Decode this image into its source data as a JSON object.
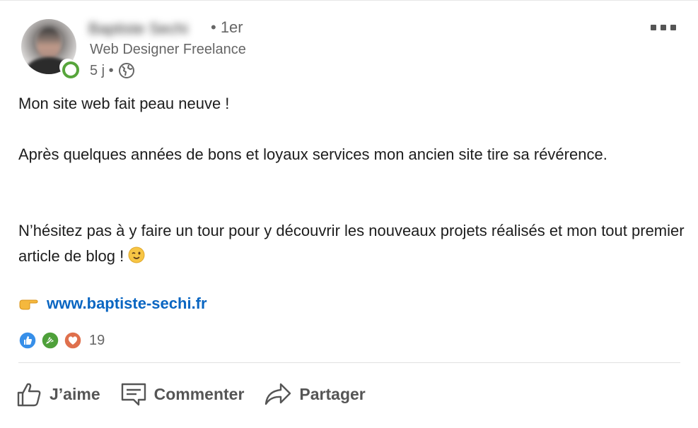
{
  "author": {
    "name": "Baptiste Sechi",
    "degree": "• 1er",
    "headline": "Web Designer Freelance",
    "time": "5 j •",
    "avatar_icon": "profile-photo",
    "visibility_icon": "globe-icon"
  },
  "post": {
    "line1": "Mon site web fait peau neuve !",
    "line2": "Après quelques années de bons et loyaux services mon ancien site tire sa révérence.",
    "line3": "N’hésitez pas à y faire un tour pour y découvrir les nouveaux projets réalisés et mon tout premier article de blog !",
    "link": "www.baptiste-sechi.fr"
  },
  "reactions": {
    "count": "19",
    "icons": [
      "like-icon",
      "celebrate-icon",
      "love-icon"
    ]
  },
  "actions": {
    "like": "J’aime",
    "comment": "Commenter",
    "share": "Partager"
  },
  "colors": {
    "link": "#0a66c2",
    "online": "#57a53b",
    "muted": "#666666"
  }
}
